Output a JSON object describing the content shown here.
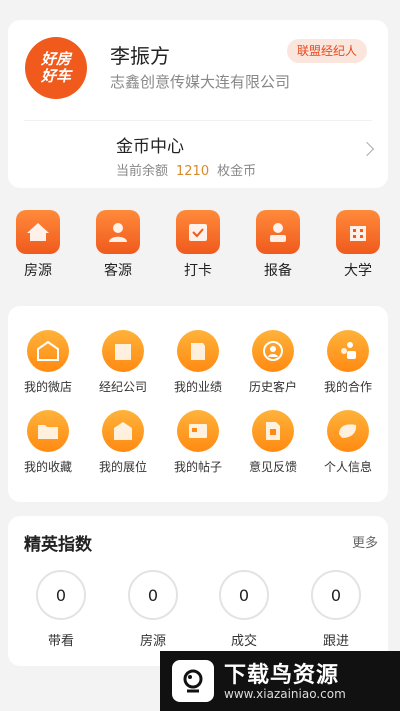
{
  "profile": {
    "logo_text": "好房好车",
    "name": "李振方",
    "company": "志鑫创意传媒大连有限公司",
    "badge": "联盟经纪人",
    "coin_title": "金币中心",
    "coin_prefix": "当前余额",
    "coin_value": "1210",
    "coin_suffix": "枚金币"
  },
  "nav": [
    {
      "label": "房源",
      "icon": "house-icon"
    },
    {
      "label": "客源",
      "icon": "customer-icon"
    },
    {
      "label": "打卡",
      "icon": "checkin-icon"
    },
    {
      "label": "报备",
      "icon": "report-icon"
    },
    {
      "label": "大学",
      "icon": "university-icon"
    }
  ],
  "features": [
    {
      "label": "我的微店",
      "icon": "shop-icon"
    },
    {
      "label": "经纪公司",
      "icon": "company-icon"
    },
    {
      "label": "我的业绩",
      "icon": "performance-icon"
    },
    {
      "label": "历史客户",
      "icon": "history-icon"
    },
    {
      "label": "我的合作",
      "icon": "cooperation-icon"
    },
    {
      "label": "我的收藏",
      "icon": "folder-icon"
    },
    {
      "label": "我的展位",
      "icon": "booth-icon"
    },
    {
      "label": "我的帖子",
      "icon": "post-icon"
    },
    {
      "label": "意见反馈",
      "icon": "feedback-icon"
    },
    {
      "label": "个人信息",
      "icon": "profile-icon"
    }
  ],
  "elite": {
    "title": "精英指数",
    "more": "更多",
    "stats": [
      {
        "label": "带看",
        "value": "0"
      },
      {
        "label": "房源",
        "value": "0"
      },
      {
        "label": "成交",
        "value": "0"
      },
      {
        "label": "跟进",
        "value": "0"
      }
    ]
  },
  "watermark": {
    "title": "下载鸟资源",
    "url": "www.xiazainiao.com"
  },
  "colors": {
    "primary": "#f05a1d",
    "feature_icon": "#ff8a12",
    "coin_value": "#d98a2b"
  }
}
